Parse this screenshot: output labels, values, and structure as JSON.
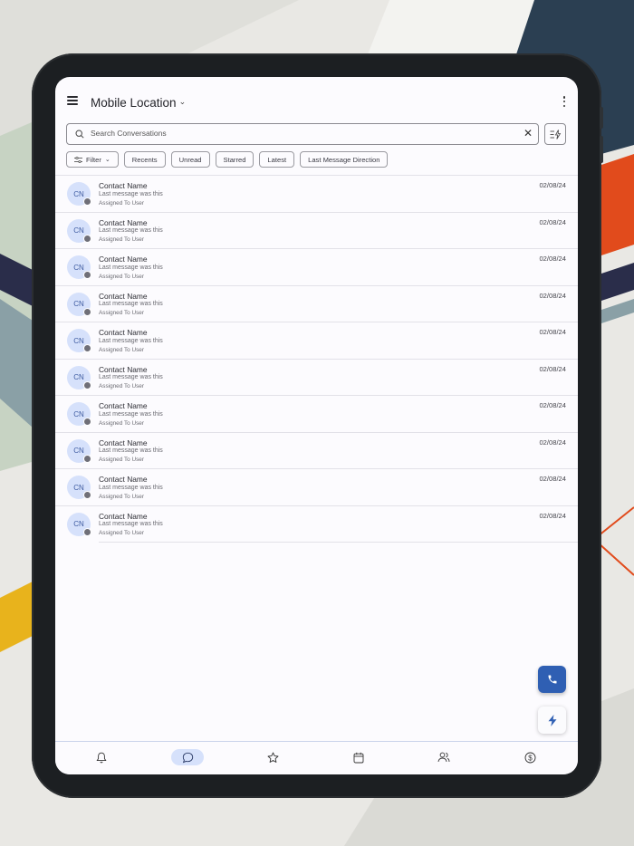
{
  "app": {
    "title": "Mobile Location",
    "title_chevron_icon": "chevron-down-icon"
  },
  "search": {
    "placeholder": "Search Conversations"
  },
  "filters": {
    "filter_label": "Filter",
    "chips": [
      "Recents",
      "Unread",
      "Starred",
      "Latest",
      "Last Message Direction"
    ]
  },
  "conversations": [
    {
      "initials": "CN",
      "name": "Contact Name",
      "message": "Last message was this",
      "assigned": "Assigned To User",
      "date": "02/08/24"
    },
    {
      "initials": "CN",
      "name": "Contact Name",
      "message": "Last message was this",
      "assigned": "Assigned To User",
      "date": "02/08/24"
    },
    {
      "initials": "CN",
      "name": "Contact Name",
      "message": "Last message was this",
      "assigned": "Assigned To User",
      "date": "02/08/24"
    },
    {
      "initials": "CN",
      "name": "Contact Name",
      "message": "Last message was this",
      "assigned": "Assigned To User",
      "date": "02/08/24"
    },
    {
      "initials": "CN",
      "name": "Contact Name",
      "message": "Last message was this",
      "assigned": "Assigned To User",
      "date": "02/08/24"
    },
    {
      "initials": "CN",
      "name": "Contact Name",
      "message": "Last message was this",
      "assigned": "Assigned To User",
      "date": "02/08/24"
    },
    {
      "initials": "CN",
      "name": "Contact Name",
      "message": "Last message was this",
      "assigned": "Assigned To User",
      "date": "02/08/24"
    },
    {
      "initials": "CN",
      "name": "Contact Name",
      "message": "Last message was this",
      "assigned": "Assigned To User",
      "date": "02/08/24"
    },
    {
      "initials": "CN",
      "name": "Contact Name",
      "message": "Last message was this",
      "assigned": "Assigned To User",
      "date": "02/08/24"
    },
    {
      "initials": "CN",
      "name": "Contact Name",
      "message": "Last message was this",
      "assigned": "Assigned To User",
      "date": "02/08/24"
    }
  ],
  "bottom_nav": {
    "items": [
      "bell-icon",
      "chat-icon",
      "star-icon",
      "calendar-icon",
      "contacts-icon",
      "dollar-icon"
    ],
    "active": "chat-icon"
  },
  "colors": {
    "accent": "#2f5fb3",
    "avatar_bg": "#d6e1fb",
    "active_nav_bg": "#d6e1fb"
  }
}
